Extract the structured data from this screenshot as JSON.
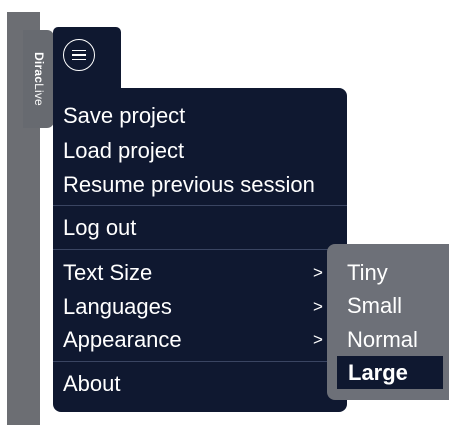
{
  "brand": {
    "part1": "Dirac",
    "part2": "Live"
  },
  "menu": {
    "items": [
      {
        "label": "Save project"
      },
      {
        "label": "Load project"
      },
      {
        "label": "Resume previous session"
      },
      {
        "label": "Log out"
      },
      {
        "label": "Text Size",
        "arrow": ">"
      },
      {
        "label": "Languages",
        "arrow": ">"
      },
      {
        "label": "Appearance",
        "arrow": ">"
      },
      {
        "label": "About"
      }
    ]
  },
  "text_size_submenu": {
    "options": [
      "Tiny",
      "Small",
      "Normal",
      "Large"
    ],
    "selected": "Large"
  },
  "colors": {
    "menu_bg": "#0f1830",
    "submenu_bg": "#6d7078",
    "sidebar": "#6c6e73",
    "text": "#ffffff"
  },
  "icons": [
    "hamburger-menu-icon"
  ]
}
